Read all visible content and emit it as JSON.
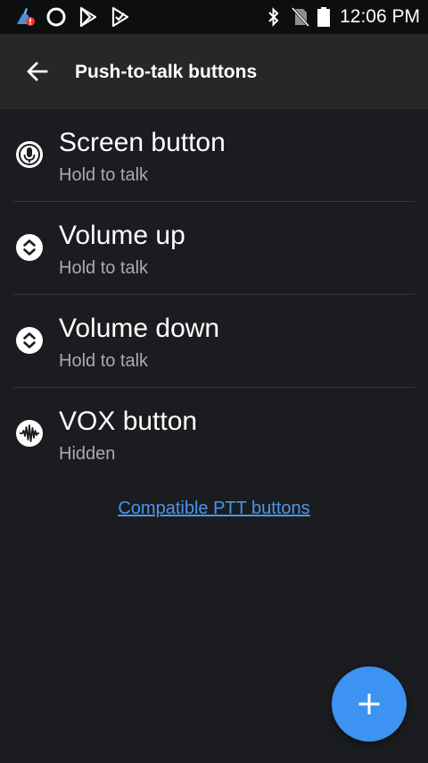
{
  "status_bar": {
    "time": "12:06 PM",
    "icons": [
      "cleaner-app-icon",
      "circle-app-icon",
      "play-store-icon",
      "play-store-alt-icon",
      "bluetooth-icon",
      "no-sim-icon",
      "battery-icon"
    ]
  },
  "app_bar": {
    "title": "Push-to-talk buttons",
    "back_icon": "arrow-back-icon"
  },
  "items": [
    {
      "title": "Screen button",
      "subtitle": "Hold to talk",
      "icon": "microphone-icon"
    },
    {
      "title": "Volume up",
      "subtitle": "Hold to talk",
      "icon": "volume-rocker-icon"
    },
    {
      "title": "Volume down",
      "subtitle": "Hold to talk",
      "icon": "volume-rocker-icon"
    },
    {
      "title": "VOX button",
      "subtitle": "Hidden",
      "icon": "waveform-icon"
    }
  ],
  "link": {
    "label": "Compatible PTT buttons"
  },
  "fab": {
    "icon": "plus-icon"
  },
  "colors": {
    "background": "#1b1c1f",
    "app_bar": "#262729",
    "accent": "#3d93f2",
    "link": "#4a97ea",
    "subtitle": "#a9aaad"
  }
}
